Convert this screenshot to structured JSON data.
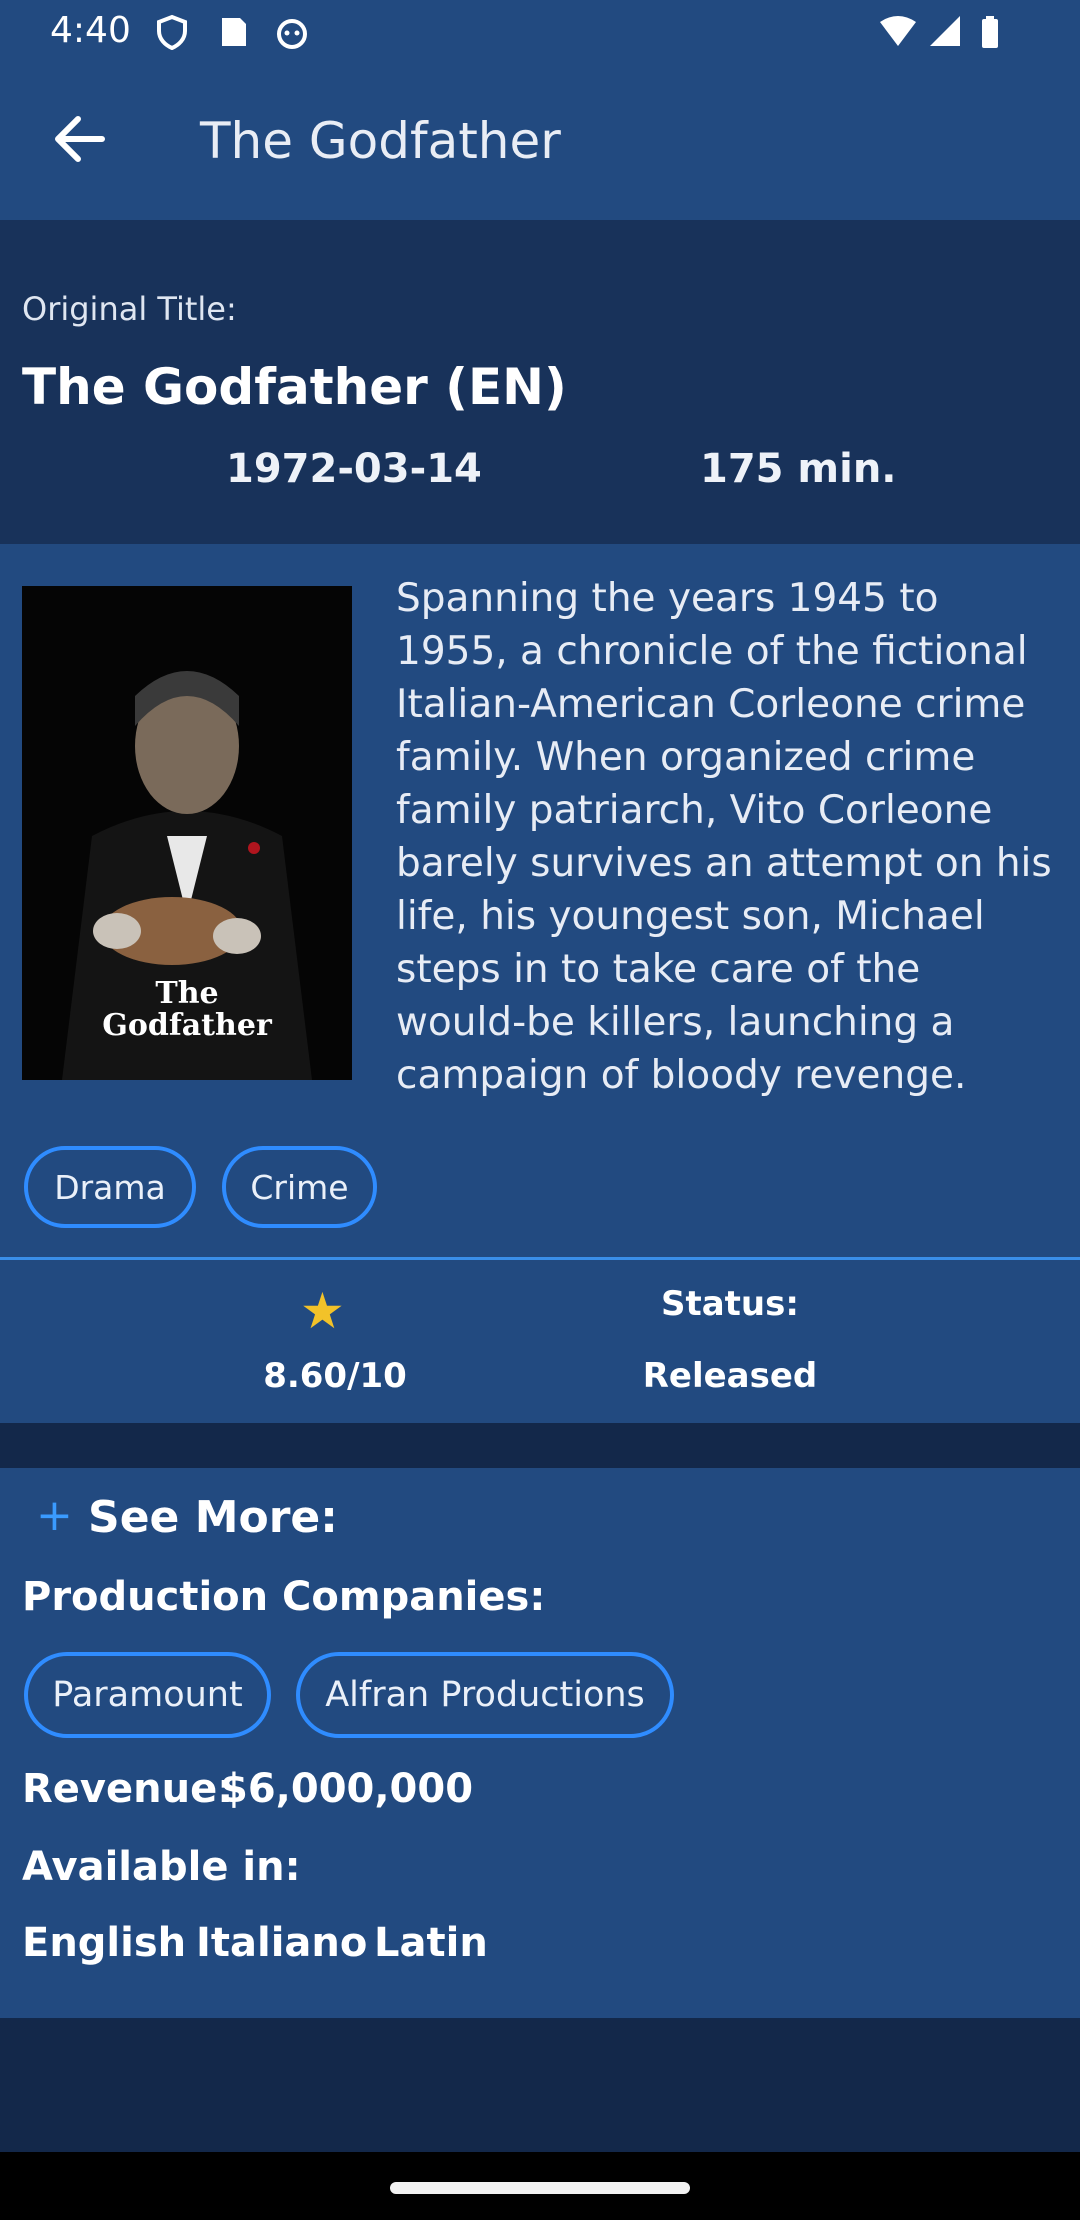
{
  "status_bar": {
    "time": "4:40"
  },
  "app_bar": {
    "title": "The Godfather"
  },
  "header": {
    "original_title_label": "Original Title:",
    "original_title": "The Godfather  (EN)",
    "release_date": "1972-03-14",
    "runtime": "175 min."
  },
  "poster": {
    "line1": "The",
    "line2": "Godfather"
  },
  "overview": "Spanning the years 1945 to 1955, a chronicle of the fictional Italian-American Corleone crime family. When organized crime family patriarch, Vito Corleone barely survives an attempt on his life, his youngest son, Michael steps in to take care of the would-be killers, launching a campaign of bloody revenge.",
  "genres": [
    "Drama",
    "Crime"
  ],
  "rating": {
    "icon": "star-icon",
    "value": "8.60/10"
  },
  "status": {
    "label": "Status:",
    "value": "Released"
  },
  "more": {
    "plus": "+",
    "label": "See More:",
    "production_label": "Production Companies:",
    "companies": [
      "Paramount",
      "Alfran Productions"
    ],
    "revenue_label": "Revenue:",
    "revenue": "$6,000,000",
    "available_label": "Available in:",
    "languages": [
      "English",
      "Italiano",
      "Latin"
    ]
  },
  "colors": {
    "app_bar": "#224a80",
    "dark_section": "#18325a",
    "accent": "#2f8cff",
    "star": "#f2c229"
  }
}
